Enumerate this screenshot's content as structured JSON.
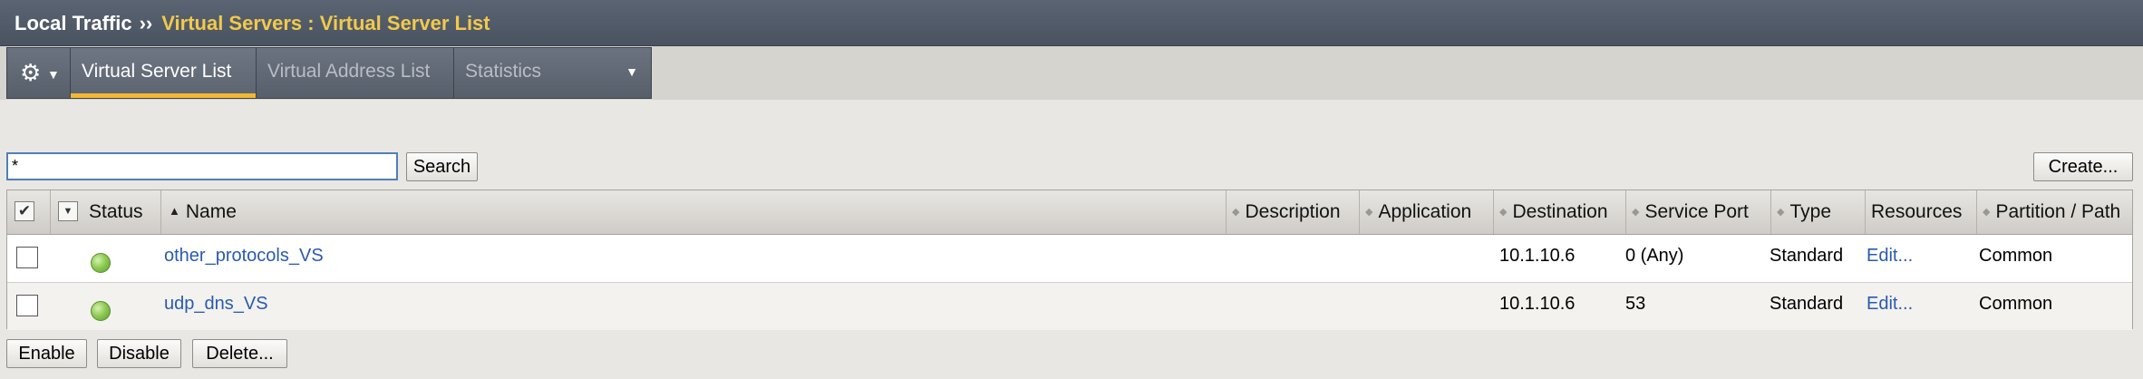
{
  "breadcrumb": {
    "section": "Local Traffic",
    "separator": "››",
    "current": "Virtual Servers : Virtual Server List"
  },
  "tabs": [
    {
      "label": "Virtual Server List",
      "active": true
    },
    {
      "label": "Virtual Address List",
      "active": false
    },
    {
      "label": "Statistics",
      "active": false
    }
  ],
  "search": {
    "value": "*",
    "button_label": "Search"
  },
  "create_label": "Create...",
  "table": {
    "columns": [
      "Status",
      "Name",
      "Description",
      "Application",
      "Destination",
      "Service Port",
      "Type",
      "Resources",
      "Partition / Path"
    ],
    "rows": [
      {
        "status": "available",
        "name": "other_protocols_VS",
        "description": "",
        "application": "",
        "destination": "10.1.10.6",
        "service_port": "0 (Any)",
        "type": "Standard",
        "resources": "Edit...",
        "partition": "Common"
      },
      {
        "status": "available",
        "name": "udp_dns_VS",
        "description": "",
        "application": "",
        "destination": "10.1.10.6",
        "service_port": "53",
        "type": "Standard",
        "resources": "Edit...",
        "partition": "Common"
      }
    ]
  },
  "actions": {
    "enable": "Enable",
    "disable": "Disable",
    "delete": "Delete..."
  },
  "colors": {
    "accent": "#f2c94c",
    "tab_underline": "#f2b833",
    "link": "#2a5ab0",
    "status_green": "#8fcc55"
  },
  "icons": {
    "gear": "gear-icon",
    "chevron": "chevron-down-icon",
    "status": "status-green-circle-icon"
  }
}
